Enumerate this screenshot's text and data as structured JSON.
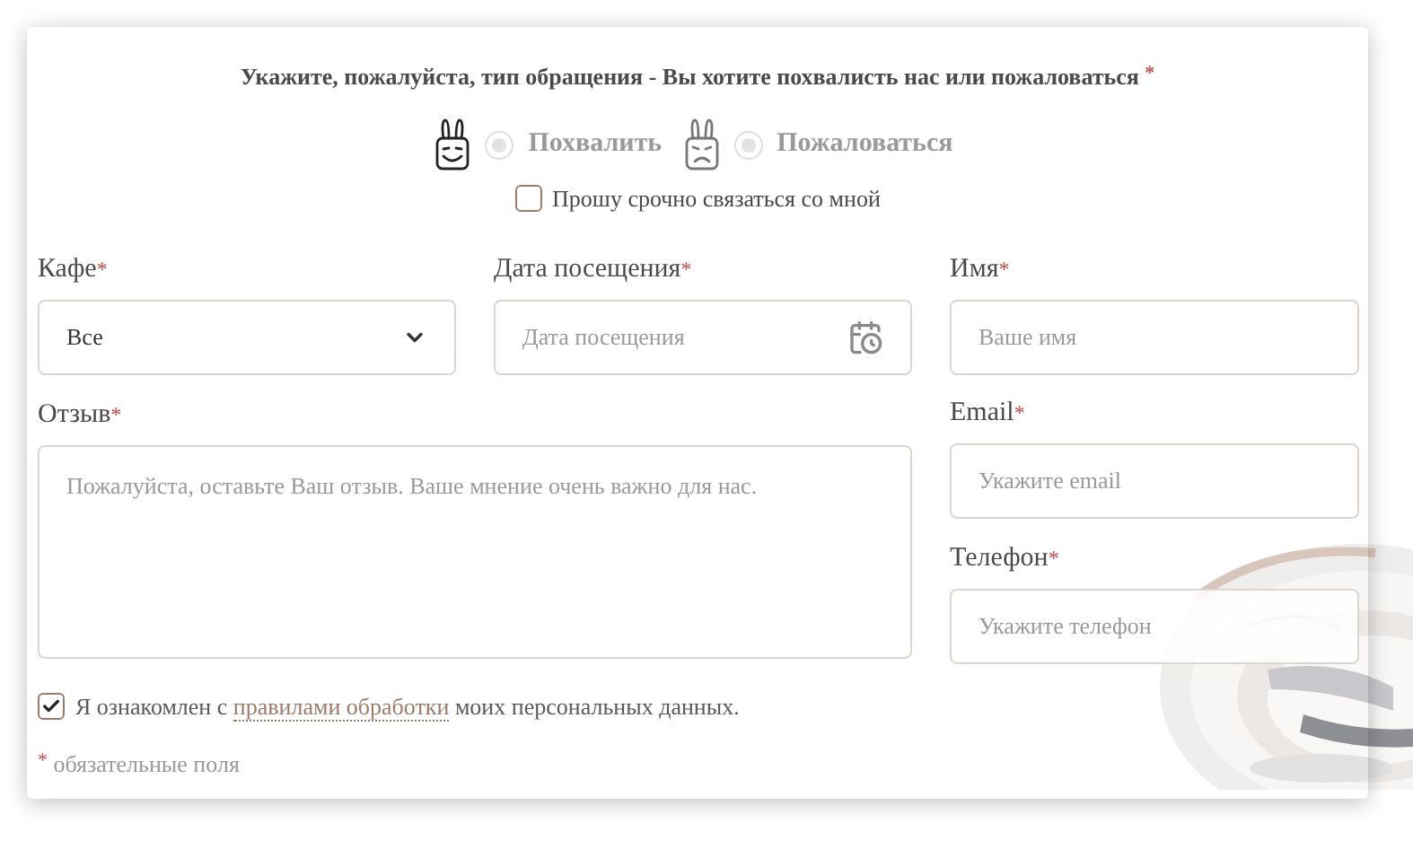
{
  "title": {
    "text": "Укажите, пожалуйста, тип обращения - Вы хотите похвалисть нас или пожаловаться",
    "required_mark": "*"
  },
  "feedback_types": [
    {
      "label": "Похвалить",
      "selected": false,
      "kind": "praise"
    },
    {
      "label": "Пожаловаться",
      "selected": false,
      "kind": "complaint"
    }
  ],
  "urgent": {
    "label": "Прошу срочно связаться со мной",
    "checked": false
  },
  "fields": {
    "cafe": {
      "label": "Кафе",
      "required_mark": "*",
      "value": "Все"
    },
    "date": {
      "label": "Дата посещения",
      "required_mark": "*",
      "placeholder": "Дата посещения"
    },
    "name": {
      "label": "Имя",
      "required_mark": "*",
      "placeholder": "Ваше имя"
    },
    "review": {
      "label": "Отзыв",
      "required_mark": "*",
      "placeholder": "Пожалуйста, оставьте Ваш отзыв. Ваше мнение очень важно для нас."
    },
    "email": {
      "label": "Email",
      "required_mark": "*",
      "placeholder": "Укажите email"
    },
    "phone": {
      "label": "Телефон",
      "required_mark": "*",
      "placeholder": "Укажите телефон"
    }
  },
  "consent": {
    "before": "Я ознакомлен с",
    "link": "правилами обработки",
    "after": "моих персональных данных.",
    "checked": true
  },
  "required_note": {
    "mark": "*",
    "text": "обязательные поля"
  }
}
